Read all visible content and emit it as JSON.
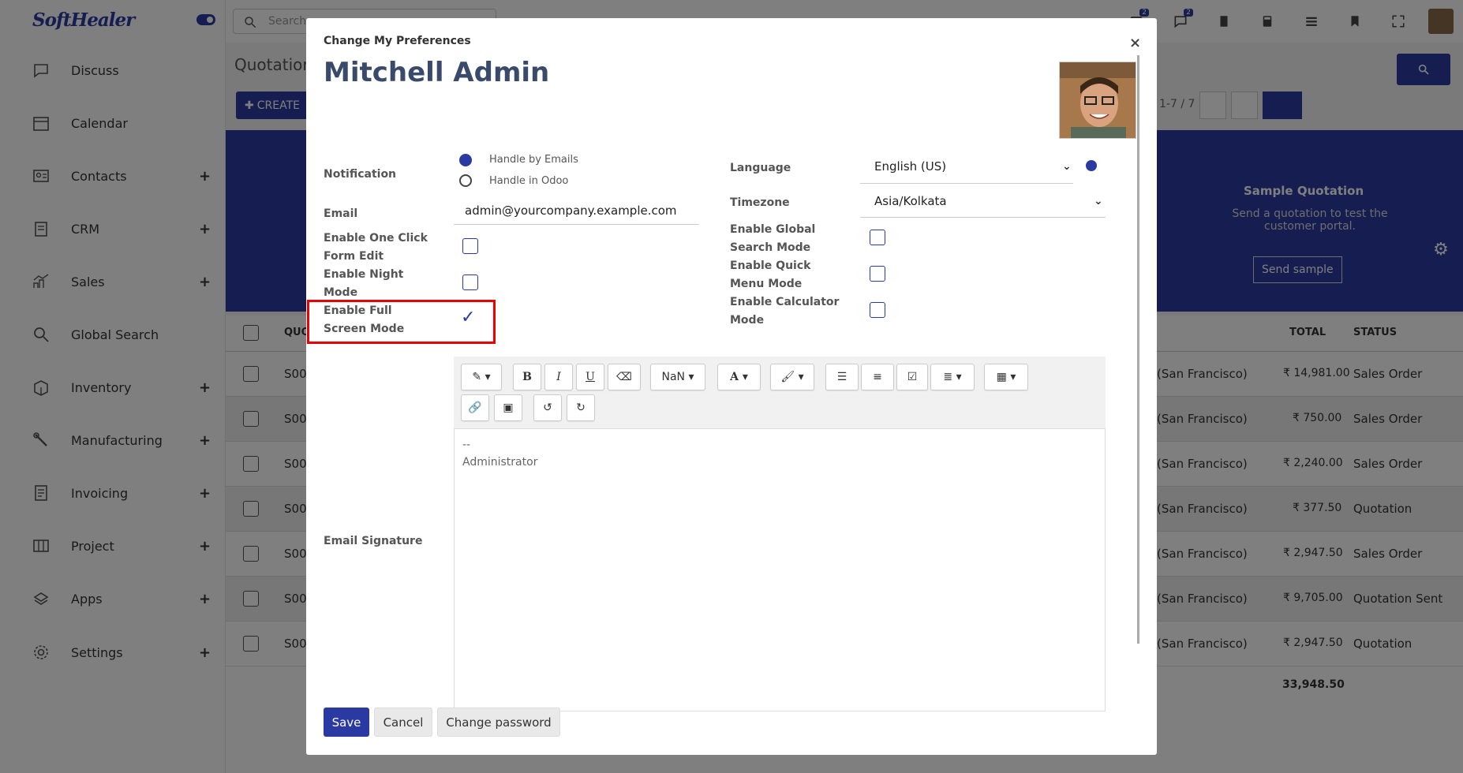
{
  "app": {
    "logo": "SoftHealer"
  },
  "sidebar": {
    "items": [
      {
        "label": "Discuss",
        "icon": "chat-icon",
        "plus": ""
      },
      {
        "label": "Calendar",
        "icon": "calendar-icon",
        "plus": ""
      },
      {
        "label": "Contacts",
        "icon": "contacts-icon",
        "plus": "+"
      },
      {
        "label": "CRM",
        "icon": "crm-icon",
        "plus": "+"
      },
      {
        "label": "Sales",
        "icon": "sales-chart-icon",
        "plus": "+"
      },
      {
        "label": "Global Search",
        "icon": "search-icon",
        "plus": ""
      },
      {
        "label": "Inventory",
        "icon": "inventory-icon",
        "plus": "+"
      },
      {
        "label": "Manufacturing",
        "icon": "wrench-icon",
        "plus": "+"
      },
      {
        "label": "Invoicing",
        "icon": "invoice-icon",
        "plus": "+"
      },
      {
        "label": "Project",
        "icon": "project-icon",
        "plus": "+"
      },
      {
        "label": "Apps",
        "icon": "apps-icon",
        "plus": "+"
      },
      {
        "label": "Settings",
        "icon": "gear-icon",
        "plus": "+"
      }
    ]
  },
  "topbar": {
    "search_placeholder": "Search...",
    "badge_activity": "2",
    "badge_messages": "2"
  },
  "content": {
    "title": "Quotations",
    "create_label": "CREATE",
    "pager": "1-7 / 7",
    "banner": {
      "title": "Sample Quotation",
      "text": "Send a quotation to test the customer portal.",
      "button": "Send sample"
    },
    "table": {
      "headers": {
        "number": "QUOTATION",
        "total": "TOTAL",
        "status": "STATUS"
      },
      "rows": [
        {
          "number": "S00",
          "customer": "(San Francisco)",
          "total": "₹ 14,981.00",
          "status": "Sales Order"
        },
        {
          "number": "S00",
          "customer": "(San Francisco)",
          "total": "₹ 750.00",
          "status": "Sales Order"
        },
        {
          "number": "S00",
          "customer": "(San Francisco)",
          "total": "₹ 2,240.00",
          "status": "Sales Order"
        },
        {
          "number": "S00",
          "customer": "(San Francisco)",
          "total": "₹ 377.50",
          "status": "Quotation"
        },
        {
          "number": "S00",
          "customer": "(San Francisco)",
          "total": "₹ 2,947.50",
          "status": "Sales Order"
        },
        {
          "number": "S00",
          "customer": "(San Francisco)",
          "total": "₹ 9,705.00",
          "status": "Quotation Sent"
        },
        {
          "number": "S00",
          "customer": "(San Francisco)",
          "total": "₹ 2,947.50",
          "status": "Quotation"
        }
      ],
      "grand_total": "33,948.50"
    }
  },
  "modal": {
    "header": "Change My Preferences",
    "close": "×",
    "user_name": "Mitchell Admin",
    "notification_label": "Notification",
    "notification_options": [
      "Handle by Emails",
      "Handle in Odoo"
    ],
    "email_label": "Email",
    "email_value": "admin@yourcompany.example.com",
    "one_click_label_1": "Enable One Click",
    "one_click_label_2": "Form Edit",
    "night_mode_label_1": "Enable Night",
    "night_mode_label_2": "Mode",
    "full_screen_label_1": "Enable Full",
    "full_screen_label_2": "Screen Mode",
    "language_label": "Language",
    "language_value": "English (US)",
    "timezone_label": "Timezone",
    "timezone_value": "Asia/Kolkata",
    "global_search_label_1": "Enable Global",
    "global_search_label_2": "Search Mode",
    "quick_menu_label_1": "Enable Quick",
    "quick_menu_label_2": "Menu Mode",
    "calculator_label_1": "Enable Calculator",
    "calculator_label_2": "Mode",
    "signature_label": "Email Signature",
    "signature_line1": "--",
    "signature_line2": "Administrator",
    "font_size": "NaN",
    "save": "Save",
    "cancel": "Cancel",
    "change_password": "Change password"
  },
  "colors": {
    "accent": "#2b3aa3",
    "highlight": "#e00000"
  }
}
